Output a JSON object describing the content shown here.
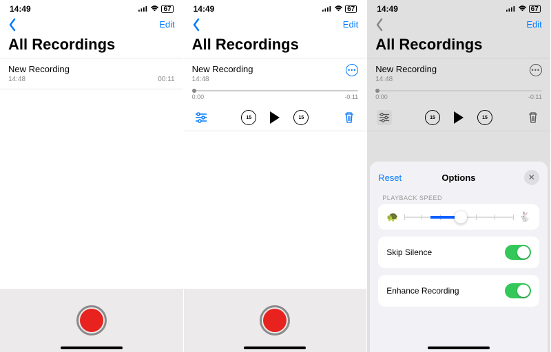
{
  "status": {
    "time": "14:49",
    "battery": "67"
  },
  "nav": {
    "edit": "Edit"
  },
  "title": "All Recordings",
  "recording": {
    "name": "New Recording",
    "time": "14:48",
    "duration": "00:11"
  },
  "scrubber": {
    "elapsed": "0:00",
    "remaining": "-0:11"
  },
  "skip": {
    "back": "15",
    "fwd": "15"
  },
  "sheet": {
    "reset": "Reset",
    "title": "Options",
    "speed_label": "PLAYBACK SPEED",
    "skip_silence": "Skip Silence",
    "enhance": "Enhance Recording"
  }
}
